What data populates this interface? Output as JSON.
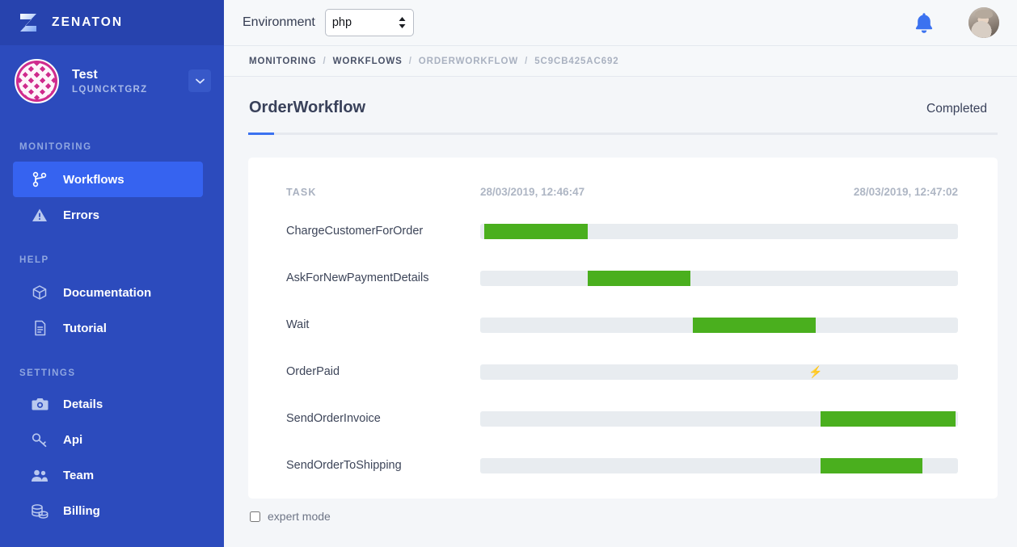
{
  "sidebar": {
    "brand": {
      "name": "ZENATON",
      "logo_icon": "zenaton-z-logo"
    },
    "account": {
      "name": "Test",
      "id": "LQUNCKTGRZ",
      "caret_icon": "chevron-down-icon",
      "avatar_icon": "identicon-avatar"
    },
    "sections": [
      {
        "title": "MONITORING",
        "items": [
          {
            "label": "Workflows",
            "icon": "branch-icon",
            "active": true
          },
          {
            "label": "Errors",
            "icon": "warning-triangle-icon",
            "active": false
          }
        ]
      },
      {
        "title": "HELP",
        "items": [
          {
            "label": "Documentation",
            "icon": "box-icon",
            "active": false
          },
          {
            "label": "Tutorial",
            "icon": "document-icon",
            "active": false
          }
        ]
      },
      {
        "title": "SETTINGS",
        "items": [
          {
            "label": "Details",
            "icon": "camera-icon",
            "active": false
          },
          {
            "label": "Api",
            "icon": "key-icon",
            "active": false
          },
          {
            "label": "Team",
            "icon": "people-icon",
            "active": false
          },
          {
            "label": "Billing",
            "icon": "coins-icon",
            "active": false
          }
        ]
      }
    ]
  },
  "topbar": {
    "environment_label": "Environment",
    "environment_value": "php",
    "environment_options": [
      "php"
    ],
    "bell_icon": "notification-bell-icon",
    "avatar_icon": "user-avatar"
  },
  "breadcrumb": {
    "items": [
      "MONITORING",
      "WORKFLOWS",
      "ORDERWORKFLOW",
      "5C9CB425AC692"
    ],
    "separator": "/"
  },
  "workflow": {
    "title": "OrderWorkflow",
    "status": "Completed"
  },
  "gantt": {
    "task_column_header": "TASK",
    "start_time": "28/03/2019, 12:46:47",
    "end_time": "28/03/2019, 12:47:02",
    "bolt_glyph": "⚡",
    "bar_color": "#4aaf1e",
    "track_color": "#e8ecf0",
    "rows": [
      {
        "task": "ChargeCustomerForOrder",
        "start_pct": 0.8,
        "end_pct": 22.5,
        "event": false
      },
      {
        "task": "AskForNewPaymentDetails",
        "start_pct": 22.5,
        "end_pct": 44.0,
        "event": false
      },
      {
        "task": "Wait",
        "start_pct": 44.5,
        "end_pct": 70.2,
        "event": false
      },
      {
        "task": "OrderPaid",
        "start_pct": 70.2,
        "end_pct": 70.2,
        "event": true,
        "event_pct": 70.2
      },
      {
        "task": "SendOrderInvoice",
        "start_pct": 71.3,
        "end_pct": 99.5,
        "event": false
      },
      {
        "task": "SendOrderToShipping",
        "start_pct": 71.3,
        "end_pct": 92.5,
        "event": false
      }
    ]
  },
  "footer": {
    "expert_mode_label": "expert mode",
    "expert_mode_checked": false
  }
}
